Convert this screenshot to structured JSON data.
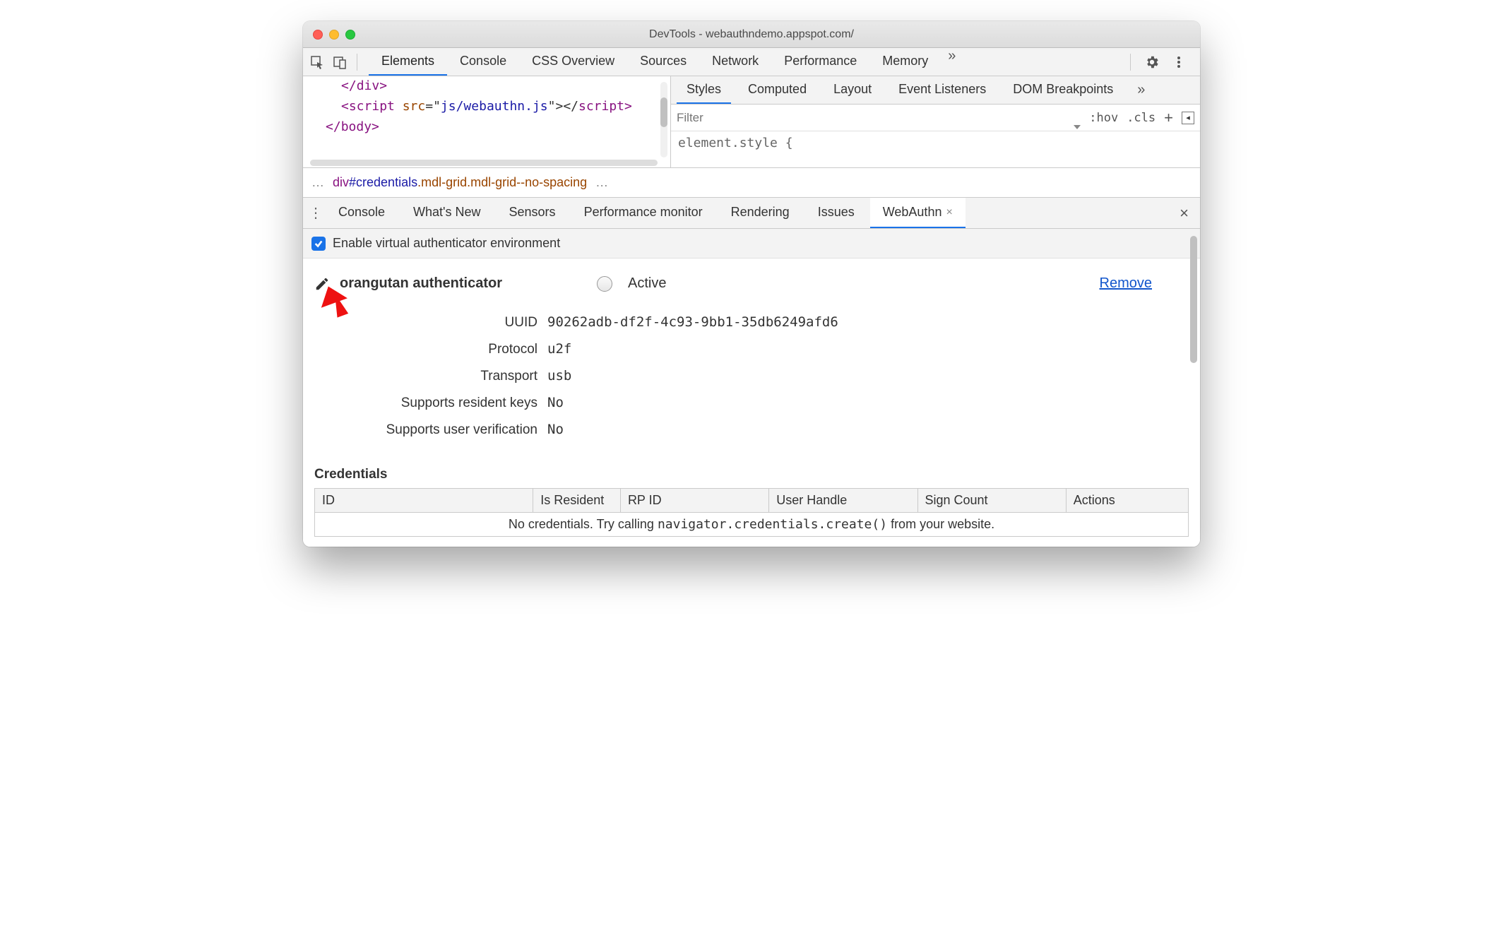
{
  "window": {
    "title": "DevTools - webauthndemo.appspot.com/"
  },
  "main_tabs": {
    "items": [
      "Elements",
      "Console",
      "CSS Overview",
      "Sources",
      "Network",
      "Performance",
      "Memory"
    ],
    "more_glyph": "»"
  },
  "code": {
    "line1_open": "</",
    "line1_tag": "div",
    "line1_close": ">",
    "line2_open": "<",
    "line2_tag": "script",
    "line2_attr": " src",
    "line2_eq": "=\"",
    "line2_val": "js/webauthn.js",
    "line2_post": "\"></",
    "line2_tag2": "script",
    "line2_end": ">",
    "line3_open": "</",
    "line3_tag": "body",
    "line3_close": ">"
  },
  "breadcrumb": {
    "dots_left": "…",
    "el": "div",
    "id": "#credentials",
    "cls1": ".mdl-grid",
    "cls2": ".mdl-grid--no-spacing",
    "dots_right": "…"
  },
  "subtabs": {
    "items": [
      "Styles",
      "Computed",
      "Layout",
      "Event Listeners",
      "DOM Breakpoints"
    ],
    "more_glyph": "»"
  },
  "filter": {
    "placeholder": "Filter",
    "hov": ":hov",
    "cls": ".cls",
    "box_glyph": "◂"
  },
  "styles_body": "element.style {",
  "drawer": {
    "items": [
      "Console",
      "What's New",
      "Sensors",
      "Performance monitor",
      "Rendering",
      "Issues",
      "WebAuthn"
    ],
    "active_index": 6,
    "close_glyph": "×"
  },
  "webauthn": {
    "enable_label": "Enable virtual authenticator environment",
    "authenticator": {
      "name": "orangutan authenticator",
      "active_label": "Active",
      "remove_label": "Remove",
      "fields": [
        {
          "k": "UUID",
          "v": "90262adb-df2f-4c93-9bb1-35db6249afd6"
        },
        {
          "k": "Protocol",
          "v": "u2f"
        },
        {
          "k": "Transport",
          "v": "usb"
        },
        {
          "k": "Supports resident keys",
          "v": "No"
        },
        {
          "k": "Supports user verification",
          "v": "No"
        }
      ]
    },
    "credentials": {
      "heading": "Credentials",
      "columns": [
        "ID",
        "Is Resident",
        "RP ID",
        "User Handle",
        "Sign Count",
        "Actions"
      ],
      "empty_pre": "No credentials. Try calling ",
      "empty_code": "navigator.credentials.create()",
      "empty_post": " from your website."
    }
  }
}
